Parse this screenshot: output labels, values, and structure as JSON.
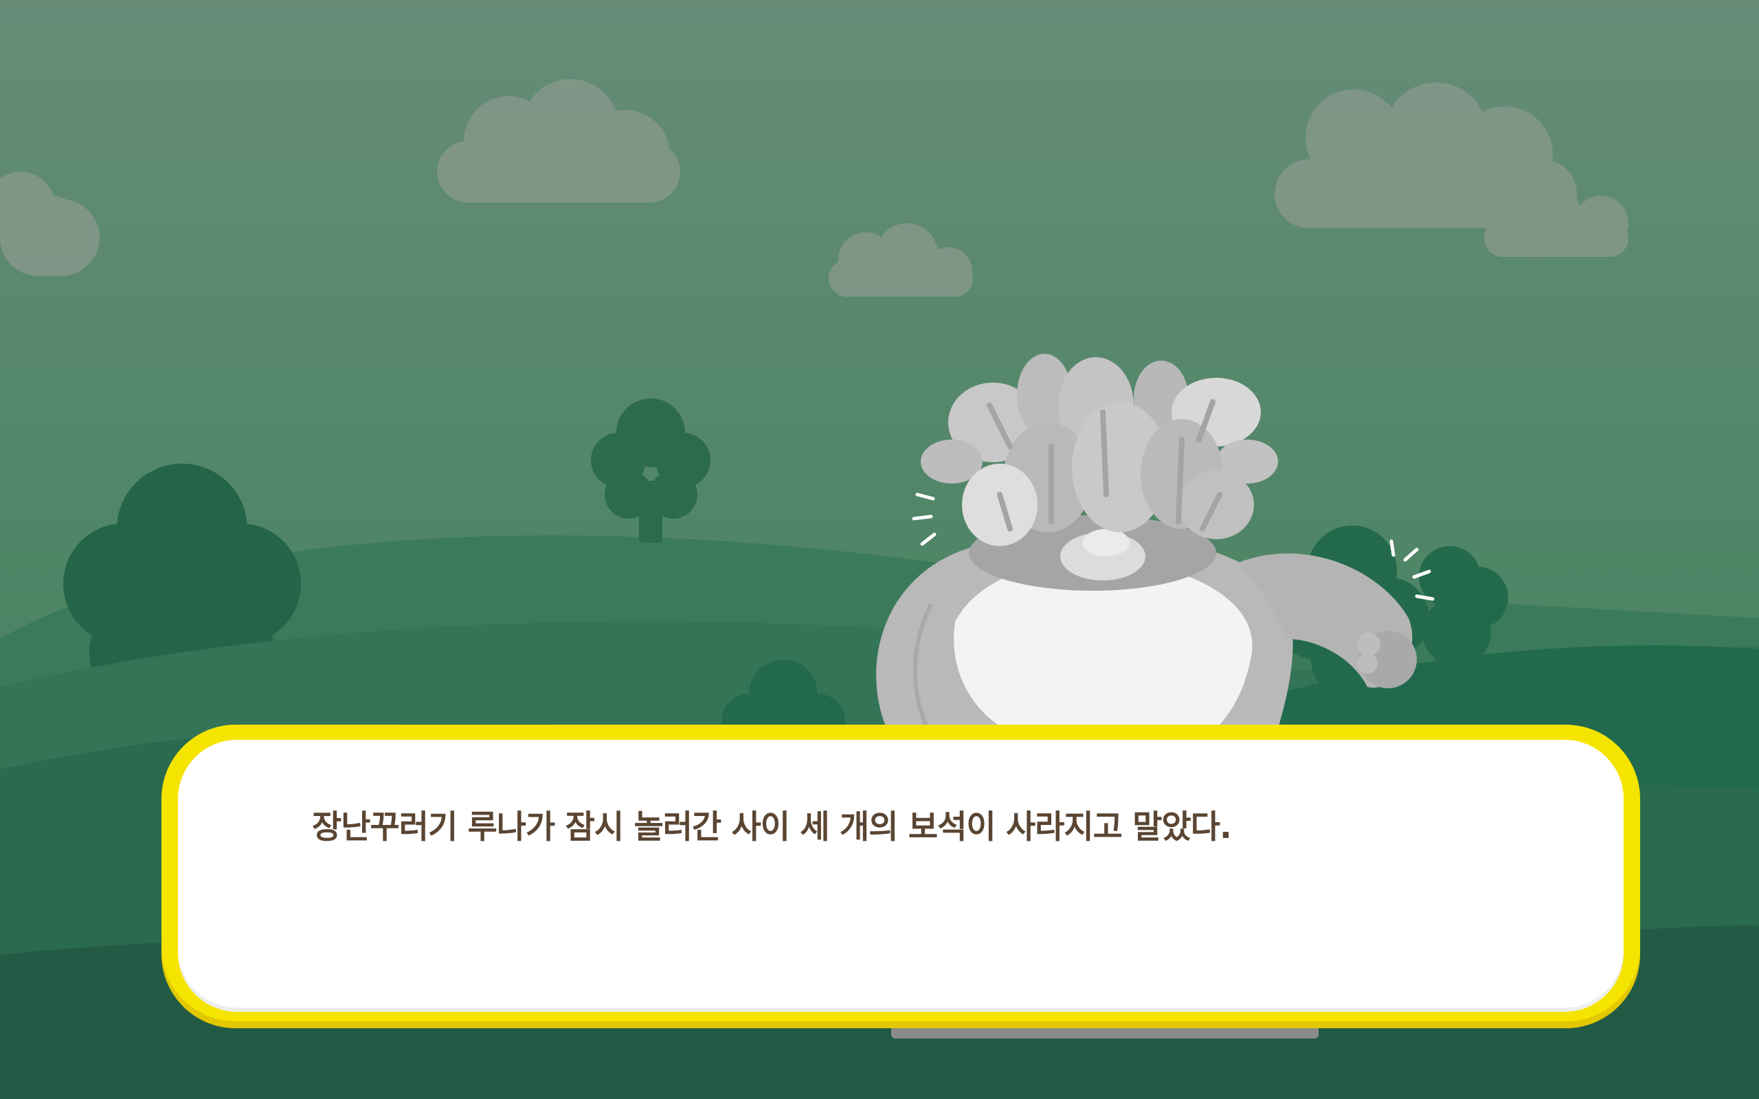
{
  "scene": {
    "name": "meadow-with-petrified-character",
    "sky_color": "#5f8b75",
    "hill_colors": [
      "#3c7a5a",
      "#357558",
      "#2a6a50",
      "#245c48"
    ],
    "tree_color": "#2c6a4e",
    "cloud_color": "#8a9a90",
    "character": {
      "description": "stone-grey leafy creature",
      "state": "petrified"
    }
  },
  "dialog": {
    "text": "장난꾸러기 루나가 잠시 놀러간 사이 세 개의 보석이 사라지고 말았다.",
    "frame_color": "#f5e400",
    "text_color": "#5a4532"
  }
}
